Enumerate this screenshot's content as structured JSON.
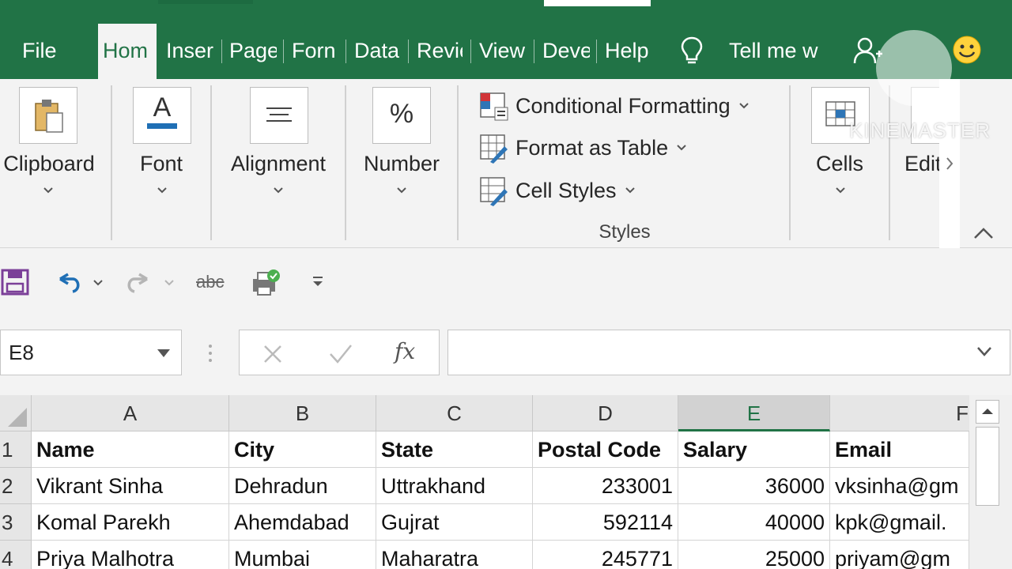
{
  "tabs": [
    {
      "label": "File",
      "name": "tab-file"
    },
    {
      "label": "Hom",
      "name": "tab-home",
      "active": true
    },
    {
      "label": "Inser",
      "name": "tab-insert"
    },
    {
      "label": "Page",
      "name": "tab-page-layout"
    },
    {
      "label": "Forn",
      "name": "tab-formulas"
    },
    {
      "label": "Data",
      "name": "tab-data"
    },
    {
      "label": "Revie",
      "name": "tab-review"
    },
    {
      "label": "View",
      "name": "tab-view"
    },
    {
      "label": "Deve",
      "name": "tab-developer"
    },
    {
      "label": "Help",
      "name": "tab-help"
    }
  ],
  "tellme": "Tell me w",
  "ribbon": {
    "clipboard": "Clipboard",
    "font": "Font",
    "font_icon": "A",
    "alignment": "Alignment",
    "number": "Number",
    "number_icon": "%",
    "cells": "Cells",
    "editing": "Edit",
    "styles_group": "Styles",
    "conditional_formatting": "Conditional Formatting",
    "format_as_table": "Format as Table",
    "cell_styles": "Cell Styles"
  },
  "qat": {
    "spelling_icon_text": "abc"
  },
  "formula_bar": {
    "name_box": "E8",
    "formula": "",
    "fx": "fx"
  },
  "watermark": "KINEMASTER",
  "grid": {
    "columns": [
      "A",
      "B",
      "C",
      "D",
      "E",
      "F"
    ],
    "selected_column": "E",
    "rows": [
      {
        "num": "1",
        "cells": [
          "Name",
          "City",
          "State",
          "Postal Code",
          "Salary",
          "Email"
        ]
      },
      {
        "num": "2",
        "cells": [
          "Vikrant Sinha",
          "Dehradun",
          "Uttrakhand",
          "233001",
          "36000",
          "vksinha@gm"
        ]
      },
      {
        "num": "3",
        "cells": [
          "Komal Parekh",
          "Ahemdabad",
          "Gujrat",
          "592114",
          "40000",
          "kpk@gmail."
        ]
      },
      {
        "num": "4",
        "cells": [
          "Priya Malhotra",
          "Mumbai",
          "Maharatra",
          "245771",
          "25000",
          "priyam@gm"
        ]
      }
    ]
  },
  "colors": {
    "excel_green": "#217346",
    "ribbon_bg": "#f3f3f3"
  }
}
